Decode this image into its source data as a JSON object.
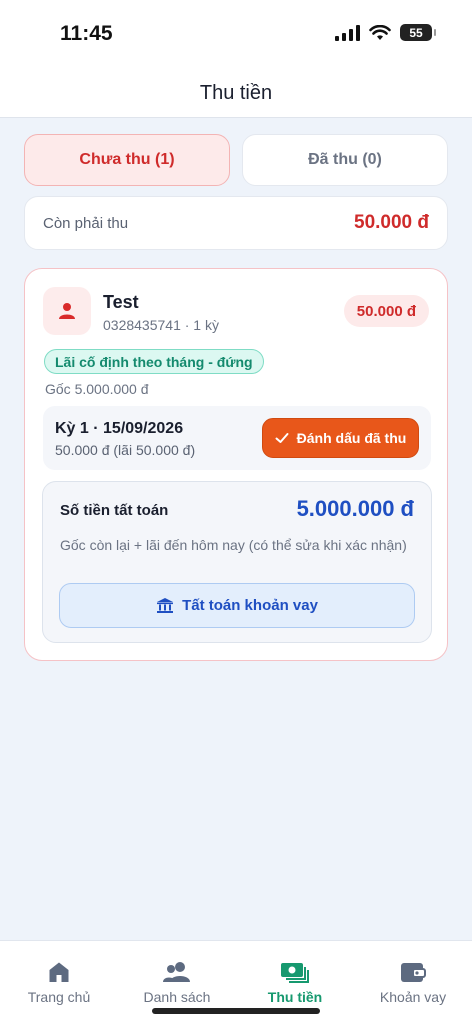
{
  "status_bar": {
    "time": "11:45",
    "battery": "55"
  },
  "header": {
    "title": "Thu tiền"
  },
  "tabs": [
    {
      "label": "Chưa thu (1)",
      "active": true
    },
    {
      "label": "Đã thu (0)",
      "active": false
    }
  ],
  "summary": {
    "label": "Còn phải thu",
    "amount": "50.000 đ"
  },
  "card": {
    "customer_name": "Test",
    "customer_sub": "0328435741 · 1 kỳ",
    "amount_badge": "50.000 đ",
    "loan_type": "Lãi cố định theo tháng - đứng",
    "principal": "Gốc 5.000.000 đ",
    "period": {
      "title": "Kỳ 1 · 15/09/2026",
      "detail": "50.000 đ (lãi 50.000 đ)",
      "mark_button": "Đánh dấu đã thu"
    },
    "settlement": {
      "label": "Số tiền tất toán",
      "amount": "5.000.000 đ",
      "note": "Gốc còn lại + lãi đến hôm nay (có thể sửa khi xác nhận)",
      "button": "Tất toán khoản vay"
    }
  },
  "bottom_nav": [
    {
      "label": "Trang chủ",
      "icon": "home-icon",
      "active": false
    },
    {
      "label": "Danh sách",
      "icon": "users-icon",
      "active": false
    },
    {
      "label": "Thu tiền",
      "icon": "cash-icon",
      "active": true
    },
    {
      "label": "Khoản vay",
      "icon": "wallet-icon",
      "active": false
    }
  ],
  "colors": {
    "accent_red": "#cf2b2b",
    "accent_green": "#17996f",
    "accent_blue": "#1f4fc2",
    "orange": "#e8571a"
  }
}
